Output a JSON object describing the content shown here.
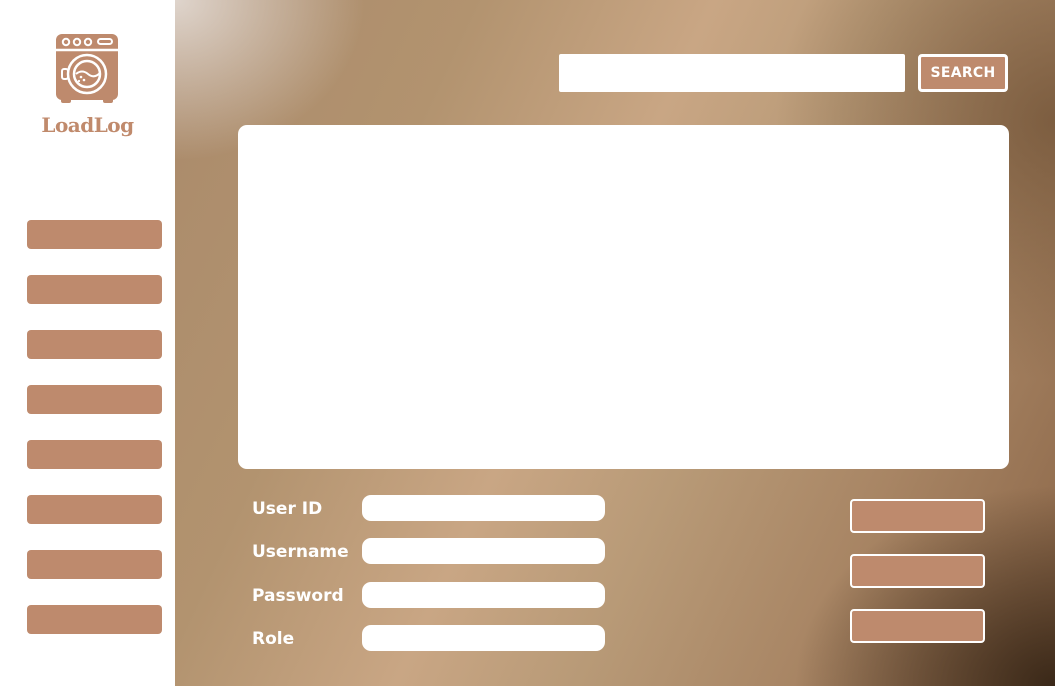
{
  "app": {
    "brand_name": "LoadLog",
    "logo_icon": "washing-machine-icon",
    "accent_color": "#be8a6d"
  },
  "sidebar": {
    "items": [
      {
        "label": ""
      },
      {
        "label": ""
      },
      {
        "label": ""
      },
      {
        "label": ""
      },
      {
        "label": ""
      },
      {
        "label": ""
      },
      {
        "label": ""
      },
      {
        "label": ""
      }
    ]
  },
  "search": {
    "value": "",
    "placeholder": "",
    "button_label": "SEARCH"
  },
  "form": {
    "fields": [
      {
        "label": "User ID",
        "value": ""
      },
      {
        "label": "Username",
        "value": ""
      },
      {
        "label": "Password",
        "value": ""
      },
      {
        "label": "Role",
        "value": ""
      }
    ]
  },
  "actions": [
    {
      "label": ""
    },
    {
      "label": ""
    },
    {
      "label": ""
    }
  ]
}
